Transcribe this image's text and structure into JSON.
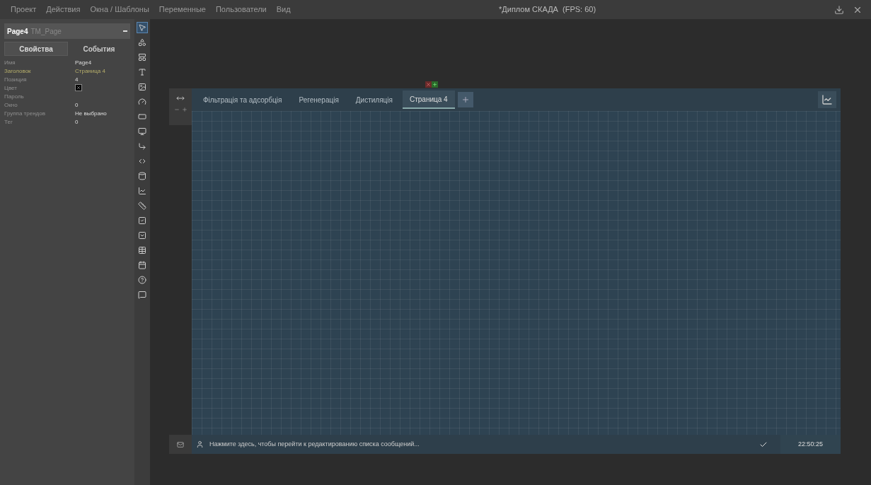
{
  "menu": [
    {
      "label": "Проект"
    },
    {
      "label": "Действия"
    },
    {
      "label": "Окна / Шаблоны"
    },
    {
      "label": "Переменные"
    },
    {
      "label": "Пользователи"
    },
    {
      "label": "Вид"
    }
  ],
  "window": {
    "title": "*Диплом СКАДА  (FPS: 60)"
  },
  "object_select": {
    "name": "Page4",
    "type": "TM_Page"
  },
  "panel_tabs": [
    {
      "label": "Свойства",
      "selected": true
    },
    {
      "label": "События",
      "selected": false
    }
  ],
  "properties": [
    {
      "name": "Имя",
      "value": "Page4",
      "kind": "text",
      "modified": false
    },
    {
      "name": "Заголовок",
      "value": "Страница 4",
      "kind": "text",
      "modified": true
    },
    {
      "name": "Позиция",
      "value": "4",
      "kind": "text",
      "modified": false
    },
    {
      "name": "Цвет",
      "kind": "color",
      "modified": false
    },
    {
      "name": "Пароль",
      "kind": "text",
      "modified": false
    },
    {
      "name": "Окно",
      "value": "0",
      "kind": "text",
      "modified": false
    },
    {
      "name": "Группа трендов",
      "value": "Не выбрано",
      "kind": "text",
      "modified": false
    },
    {
      "name": "Тег",
      "value": "0",
      "kind": "text",
      "modified": false
    }
  ],
  "tools": [
    {
      "kind": "pointer",
      "selected": true
    },
    {
      "kind": "shapes",
      "selected": false
    },
    {
      "kind": "panel",
      "selected": false
    },
    {
      "kind": "text",
      "selected": false
    },
    {
      "kind": "image",
      "selected": false
    },
    {
      "kind": "gauge",
      "selected": false
    },
    {
      "kind": "input",
      "selected": false
    },
    {
      "kind": "display",
      "selected": false
    },
    {
      "kind": "pipe",
      "selected": false
    },
    {
      "kind": "valve",
      "selected": false
    },
    {
      "kind": "tank",
      "selected": false
    },
    {
      "kind": "trend",
      "selected": false
    },
    {
      "kind": "scale",
      "selected": false
    },
    {
      "kind": "checkbox",
      "selected": false
    },
    {
      "kind": "combo",
      "selected": false
    },
    {
      "kind": "table",
      "selected": false
    },
    {
      "kind": "calendar",
      "selected": false
    },
    {
      "kind": "help",
      "selected": false
    },
    {
      "kind": "message",
      "selected": false
    }
  ],
  "pages": [
    {
      "label": "Фільтрація та адсорбція",
      "selected": false
    },
    {
      "label": "Регенерація",
      "selected": false
    },
    {
      "label": "Дистиляція",
      "selected": false
    },
    {
      "label": "Страница 4",
      "selected": true
    }
  ],
  "status": {
    "message": "Нажмите здесь, чтобы перейти к редактированию списка сообщений...",
    "time": "22:50:25"
  }
}
